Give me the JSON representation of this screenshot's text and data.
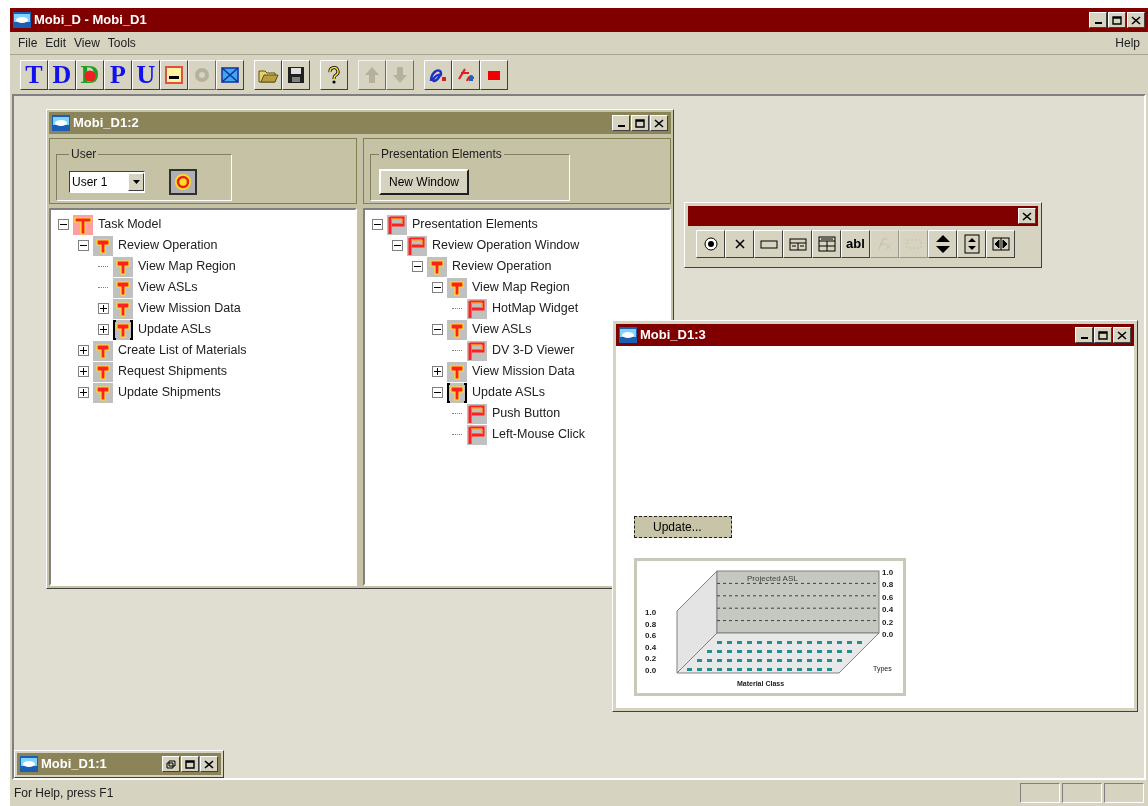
{
  "window": {
    "title": "Mobi_D - Mobi_D1",
    "active": true
  },
  "menu": {
    "items": [
      "File",
      "Edit",
      "View",
      "Tools"
    ],
    "help": "Help"
  },
  "toolbar": [
    [
      {
        "kind": "letter",
        "text": "T",
        "disabled": false
      },
      {
        "kind": "letter",
        "text": "D",
        "disabled": false
      },
      {
        "kind": "letter-dot",
        "text": "D",
        "disabled": false
      },
      {
        "kind": "letter",
        "text": "P",
        "disabled": false
      },
      {
        "kind": "letter",
        "text": "U",
        "disabled": false
      },
      {
        "kind": "panel",
        "disabled": false
      },
      {
        "kind": "gear",
        "disabled": true
      },
      {
        "kind": "envelope",
        "disabled": false
      }
    ],
    [
      {
        "kind": "open",
        "disabled": false
      },
      {
        "kind": "save",
        "disabled": false
      }
    ],
    [
      {
        "kind": "help",
        "disabled": false
      }
    ],
    [
      {
        "kind": "up",
        "disabled": true
      },
      {
        "kind": "down",
        "disabled": true
      }
    ],
    [
      {
        "kind": "font-a",
        "disabled": false
      },
      {
        "kind": "font-b",
        "disabled": false
      },
      {
        "kind": "stop",
        "disabled": false
      }
    ]
  ],
  "child_windows": {
    "tasks": {
      "title": "Mobi_D1:2",
      "active": false,
      "user_group": {
        "legend": "User",
        "combo_value": "User 1"
      },
      "presentation_group": {
        "legend": "Presentation Elements",
        "button": "New Window"
      },
      "task_tree": [
        {
          "label": "Task Model",
          "kind": "task-root",
          "expanded": true,
          "children": [
            {
              "label": "Review Operation",
              "kind": "task",
              "expanded": true,
              "children": [
                {
                  "label": "View Map Region",
                  "kind": "task"
                },
                {
                  "label": "View ASLs",
                  "kind": "task"
                },
                {
                  "label": "View Mission Data",
                  "kind": "task",
                  "expanded": false
                },
                {
                  "label": "Update ASLs",
                  "kind": "task-framed",
                  "expanded": false
                }
              ]
            },
            {
              "label": "Create List of Materials",
              "kind": "task",
              "expanded": false
            },
            {
              "label": "Request Shipments",
              "kind": "task",
              "expanded": false
            },
            {
              "label": "Update Shipments",
              "kind": "task",
              "expanded": false
            }
          ]
        }
      ],
      "element_tree": [
        {
          "label": "Presentation Elements",
          "kind": "element",
          "expanded": true,
          "children": [
            {
              "label": "Review Operation Window",
              "kind": "element",
              "expanded": true,
              "children": [
                {
                  "label": "Review Operation",
                  "kind": "task",
                  "expanded": true,
                  "children": [
                    {
                      "label": "View Map Region",
                      "kind": "task",
                      "expanded": true,
                      "children": [
                        {
                          "label": "HotMap Widget",
                          "kind": "element"
                        }
                      ]
                    },
                    {
                      "label": "View ASLs",
                      "kind": "task",
                      "expanded": true,
                      "children": [
                        {
                          "label": "DV 3-D Viewer",
                          "kind": "element"
                        }
                      ]
                    },
                    {
                      "label": "View Mission Data",
                      "kind": "task",
                      "expanded": false
                    },
                    {
                      "label": "Update ASLs",
                      "kind": "task-framed",
                      "expanded": true,
                      "children": [
                        {
                          "label": "Push Button",
                          "kind": "element"
                        },
                        {
                          "label": "Left-Mouse Click",
                          "kind": "element"
                        }
                      ]
                    }
                  ]
                }
              ]
            }
          ]
        }
      ]
    },
    "palette": {
      "active": true,
      "tools": [
        {
          "kind": "radio",
          "disabled": false
        },
        {
          "kind": "check",
          "disabled": false
        },
        {
          "kind": "rect",
          "disabled": false
        },
        {
          "kind": "grid",
          "disabled": false
        },
        {
          "kind": "table",
          "disabled": false
        },
        {
          "kind": "text",
          "text": "abl",
          "disabled": false
        },
        {
          "kind": "fx",
          "disabled": true
        },
        {
          "kind": "blank",
          "disabled": true
        },
        {
          "kind": "updown",
          "disabled": false
        },
        {
          "kind": "spin",
          "disabled": false
        },
        {
          "kind": "slider",
          "disabled": false
        }
      ]
    },
    "viewer": {
      "title": "Mobi_D1:3",
      "active": true,
      "button": "Update...",
      "chart": {
        "title": "Projected ASL",
        "left_ticks": [
          "1.0",
          "0.8",
          "0.6",
          "0.4",
          "0.2",
          "0.0"
        ],
        "right_ticks": [
          "1.0",
          "0.8",
          "0.6",
          "0.4",
          "0.2",
          "0.0"
        ],
        "xlabel": "Material Class",
        "zlabel": "Types"
      }
    },
    "minimized": {
      "title": "Mobi_D1:1",
      "active": false
    }
  },
  "status_bar": {
    "text": "For Help, press F1"
  }
}
